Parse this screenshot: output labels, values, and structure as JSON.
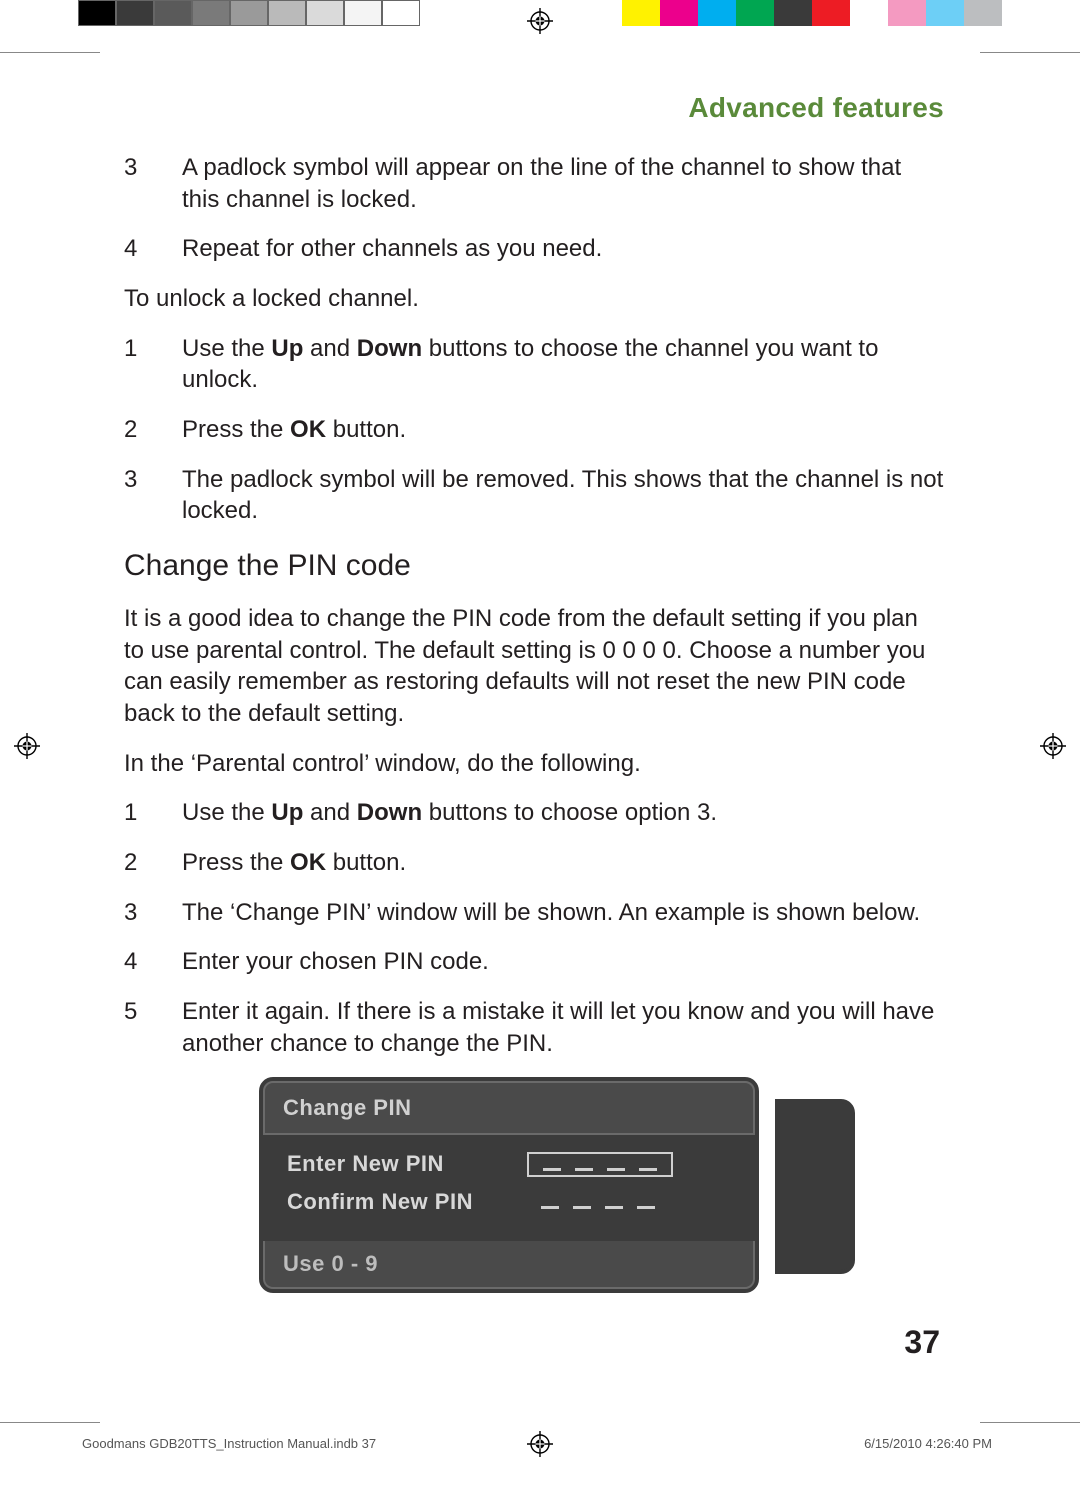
{
  "header": {
    "title": "Advanced features"
  },
  "lock_steps": [
    {
      "num": "3",
      "text": "A padlock symbol will appear on the line of the channel to show that this channel is locked."
    },
    {
      "num": "4",
      "text": "Repeat for other channels as you need."
    }
  ],
  "unlock_intro": "To unlock a locked channel.",
  "unlock_steps": [
    {
      "num": "1",
      "pre": "Use the ",
      "b1": "Up",
      "mid": " and ",
      "b2": "Down",
      "post": " buttons to choose the channel you want to unlock."
    },
    {
      "num": "2",
      "pre": "Press the ",
      "b1": "OK",
      "mid": "",
      "b2": "",
      "post": " button."
    },
    {
      "num": "3",
      "pre": "The padlock symbol will be removed. This shows that the channel is not locked.",
      "b1": "",
      "mid": "",
      "b2": "",
      "post": ""
    }
  ],
  "section_heading": "Change the PIN code",
  "pin_intro": "It is a good idea to change the PIN code from the default setting if you plan to use parental control. The default setting is 0 0 0 0. Choose a number you can easily remember as restoring defaults will not reset the new PIN code back to the default setting.",
  "pin_window_intro": "In the ‘Parental control’ window, do the following.",
  "pin_steps": [
    {
      "num": "1",
      "pre": "Use the ",
      "b1": "Up",
      "mid": " and ",
      "b2": "Down",
      "post": " buttons to choose option 3."
    },
    {
      "num": "2",
      "pre": "Press the ",
      "b1": "OK",
      "mid": "",
      "b2": "",
      "post": " button."
    },
    {
      "num": "3",
      "pre": "The ‘Change PIN’ window will be shown. An example is shown below.",
      "b1": "",
      "mid": "",
      "b2": "",
      "post": ""
    },
    {
      "num": "4",
      "pre": "Enter your chosen PIN code.",
      "b1": "",
      "mid": "",
      "b2": "",
      "post": ""
    },
    {
      "num": "5",
      "pre": "Enter it again. If there is a mistake it will let you know and you will have another chance to change the PIN.",
      "b1": "",
      "mid": "",
      "b2": "",
      "post": ""
    }
  ],
  "dialog": {
    "title": "Change PIN",
    "row1": "Enter New PIN",
    "row2": "Confirm New PIN",
    "footer": "Use 0 - 9"
  },
  "page_number": "37",
  "footer": {
    "left": "Goodmans GDB20TTS_Instruction Manual.indb   37",
    "right": "6/15/2010   4:26:40 PM"
  },
  "colorbars": {
    "left": [
      "#000000",
      "#3a3a3a",
      "#5a5a5a",
      "#7a7a7a",
      "#9a9a9a",
      "#bababa",
      "#dadada",
      "#f4f4f4",
      "#ffffff"
    ],
    "right": [
      "#fff200",
      "#ec008c",
      "#00aeef",
      "#00a651",
      "#3a3a3a",
      "#ed1c24",
      "#ffffff",
      "#f49ac1",
      "#6dcff6",
      "#bcbec0"
    ]
  }
}
